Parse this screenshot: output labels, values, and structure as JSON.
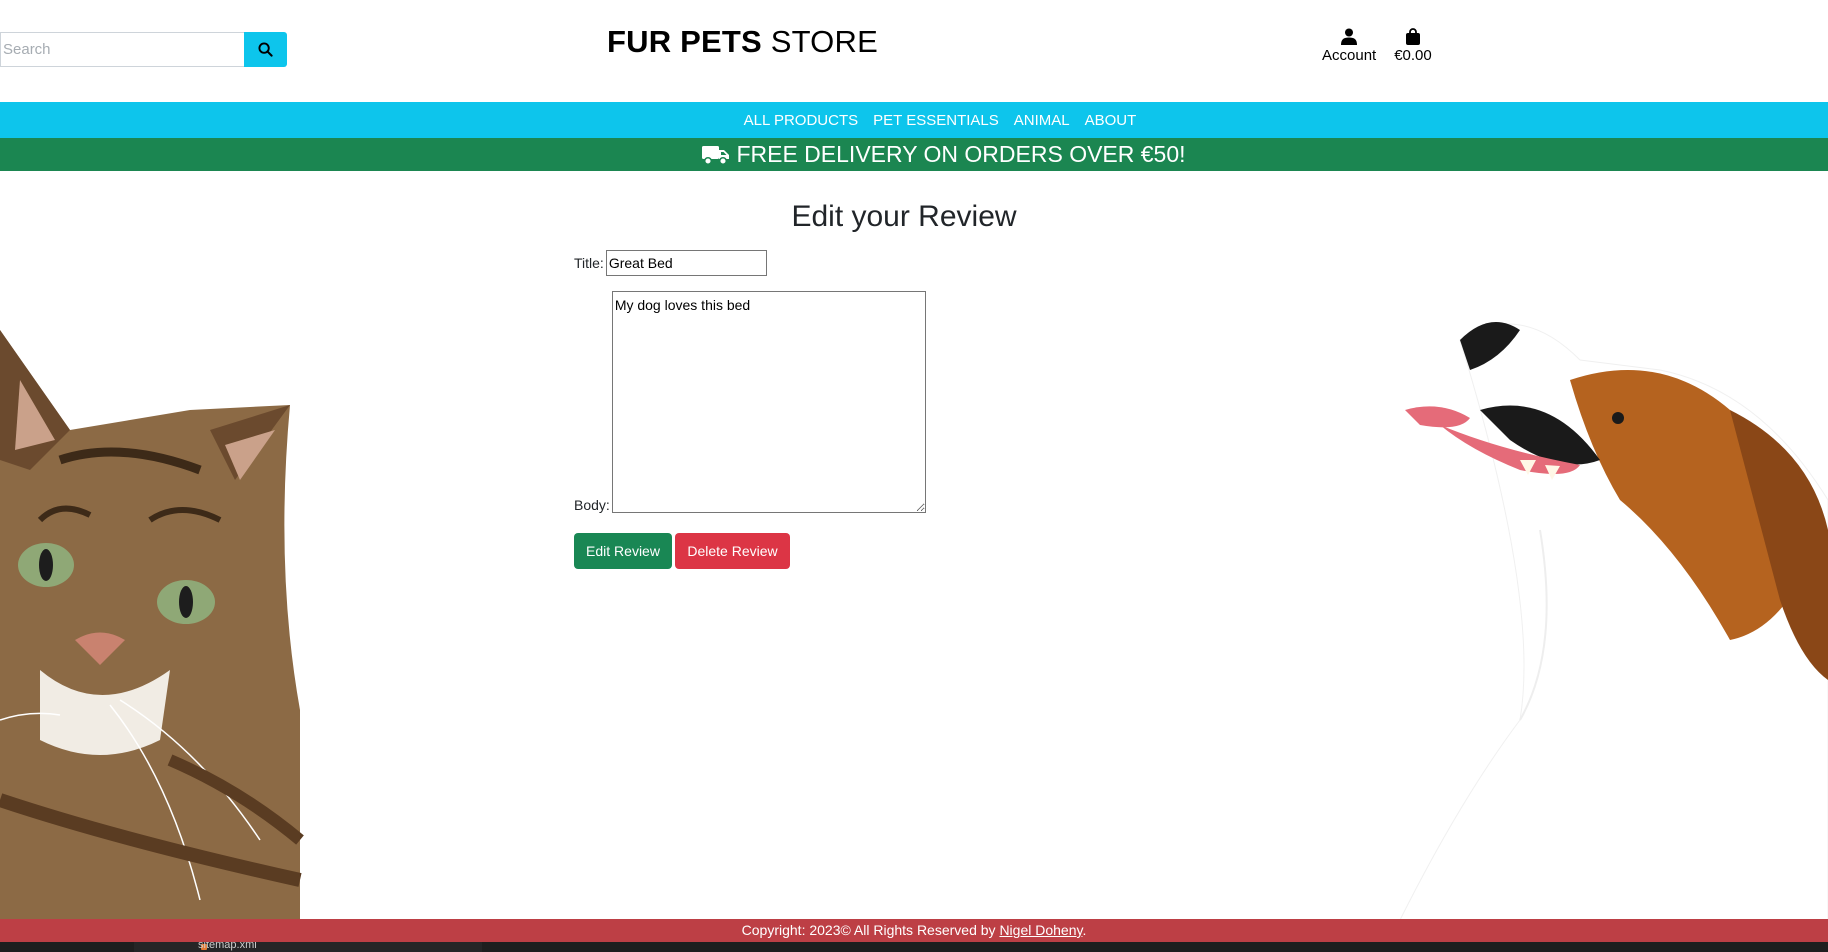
{
  "header": {
    "search_placeholder": "Search",
    "logo_bold": "FUR PETS",
    "logo_light": "STORE",
    "account_label": "Account",
    "bag_total": "€0.00"
  },
  "nav": {
    "items": [
      "ALL PRODUCTS",
      "PET ESSENTIALS",
      "ANIMAL",
      "ABOUT"
    ]
  },
  "promo": {
    "text": "FREE DELIVERY ON ORDERS OVER €50!"
  },
  "form": {
    "heading": "Edit your Review",
    "title_label": "Title:",
    "title_value": "Great Bed",
    "body_label": "Body:",
    "body_value": "My dog loves this bed",
    "edit_button": "Edit Review",
    "delete_button": "Delete Review"
  },
  "footer": {
    "text": "Copyright: 2023© All Rights Reserved by ",
    "author": "Nigel Doheny",
    "suffix": "."
  },
  "taskbar": {
    "file": "sitemap.xml"
  },
  "colors": {
    "nav": "#0dc5ec",
    "promo": "#1b8651",
    "footer": "#bd3f45",
    "edit": "#198754",
    "delete": "#dc3545"
  },
  "icons": {
    "search": "search-icon",
    "account": "user-icon",
    "bag": "shopping-bag-icon",
    "promo": "truck-icon"
  }
}
